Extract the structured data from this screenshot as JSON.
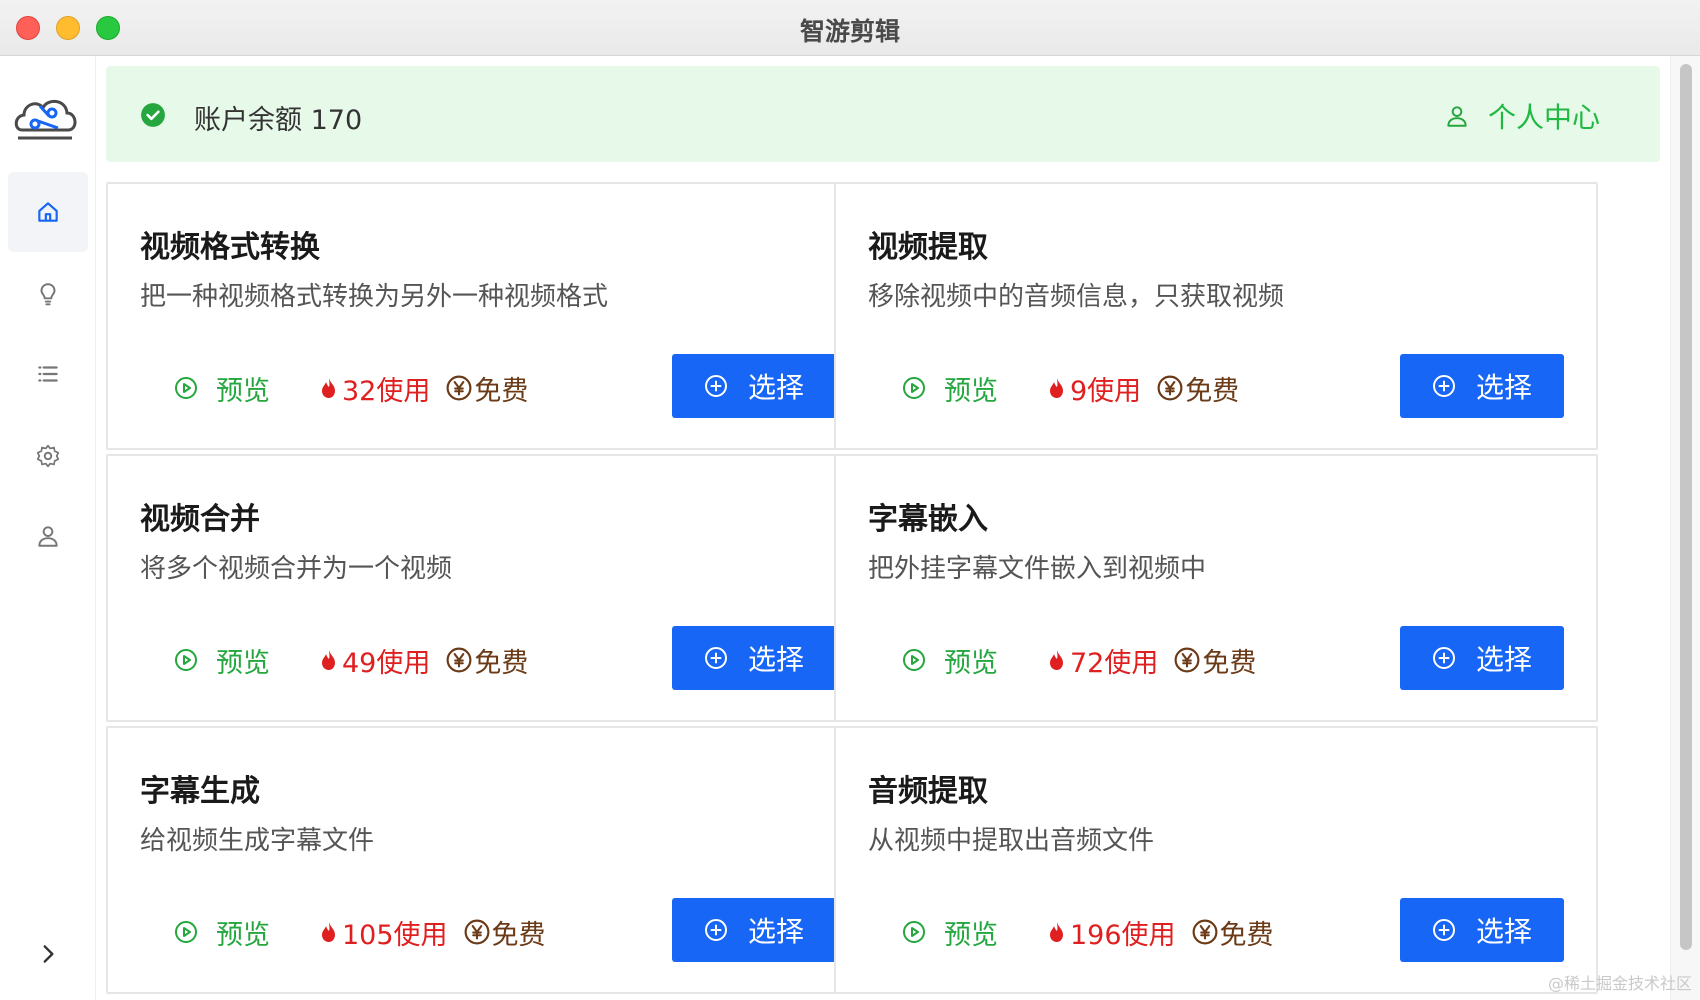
{
  "window": {
    "title": "智游剪辑"
  },
  "banner": {
    "balance_text": "账户余额 170",
    "user_center": "个人中心"
  },
  "colors": {
    "primary": "#1766f5",
    "success": "#25a63e",
    "hot": "#e02020",
    "price": "#6b3a17",
    "banner_bg": "#e7fae9"
  },
  "cards": [
    {
      "title": "视频格式转换",
      "desc": "把一种视频格式转换为另外一种视频格式",
      "preview": "预览",
      "usage": "32使用",
      "price": "免费",
      "select": "选择"
    },
    {
      "title": "视频提取",
      "desc": "移除视频中的音频信息，只获取视频",
      "preview": "预览",
      "usage": "9使用",
      "price": "免费",
      "select": "选择"
    },
    {
      "title": "视频合并",
      "desc": "将多个视频合并为一个视频",
      "preview": "预览",
      "usage": "49使用",
      "price": "免费",
      "select": "选择"
    },
    {
      "title": "字幕嵌入",
      "desc": "把外挂字幕文件嵌入到视频中",
      "preview": "预览",
      "usage": "72使用",
      "price": "免费",
      "select": "选择"
    },
    {
      "title": "字幕生成",
      "desc": "给视频生成字幕文件",
      "preview": "预览",
      "usage": "105使用",
      "price": "免费",
      "select": "选择"
    },
    {
      "title": "音频提取",
      "desc": "从视频中提取出音频文件",
      "preview": "预览",
      "usage": "196使用",
      "price": "免费",
      "select": "选择"
    }
  ],
  "icons": [
    "home-icon",
    "bulb-icon",
    "list-icon",
    "gear-icon",
    "user-icon",
    "chevron-right-icon"
  ],
  "watermark": "@稀土掘金技术社区"
}
